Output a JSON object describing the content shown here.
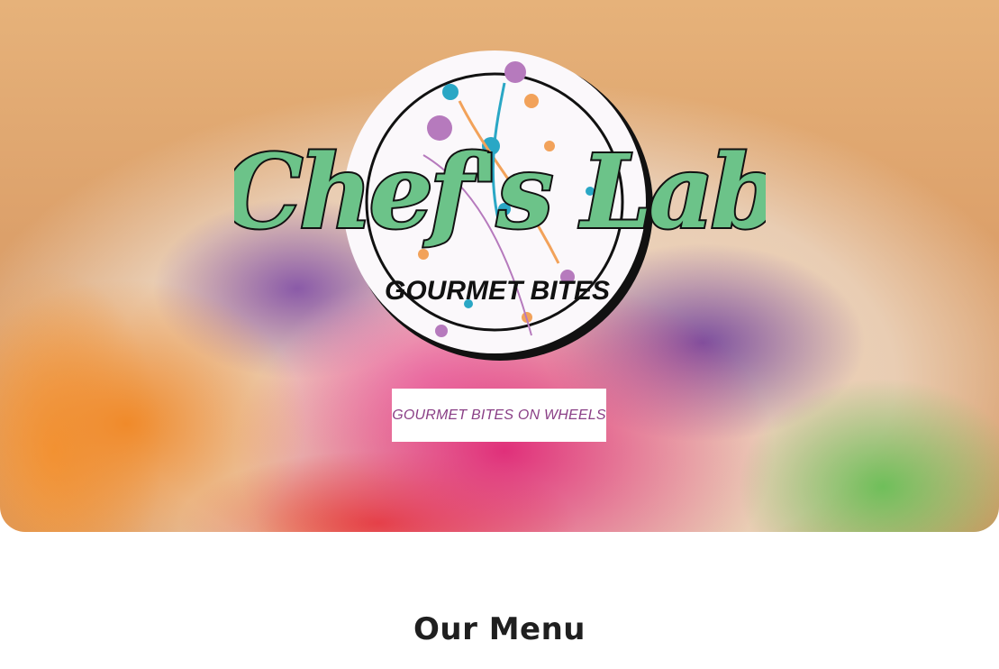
{
  "hero": {
    "background": "food-bowl-photo",
    "logo": {
      "title": "Chef's Lab",
      "subtitle": "GOURMET BITES",
      "colors": {
        "script_green": "#6cc389",
        "badge_white": "#fbf8fb",
        "outline": "#111111"
      }
    },
    "tagline": "GOURMET BITES ON WHEELS"
  },
  "menu_section": {
    "title": "Our Menu"
  },
  "colors": {
    "accent_purple": "#8a3f86",
    "text_dark": "#1f1f1f"
  }
}
